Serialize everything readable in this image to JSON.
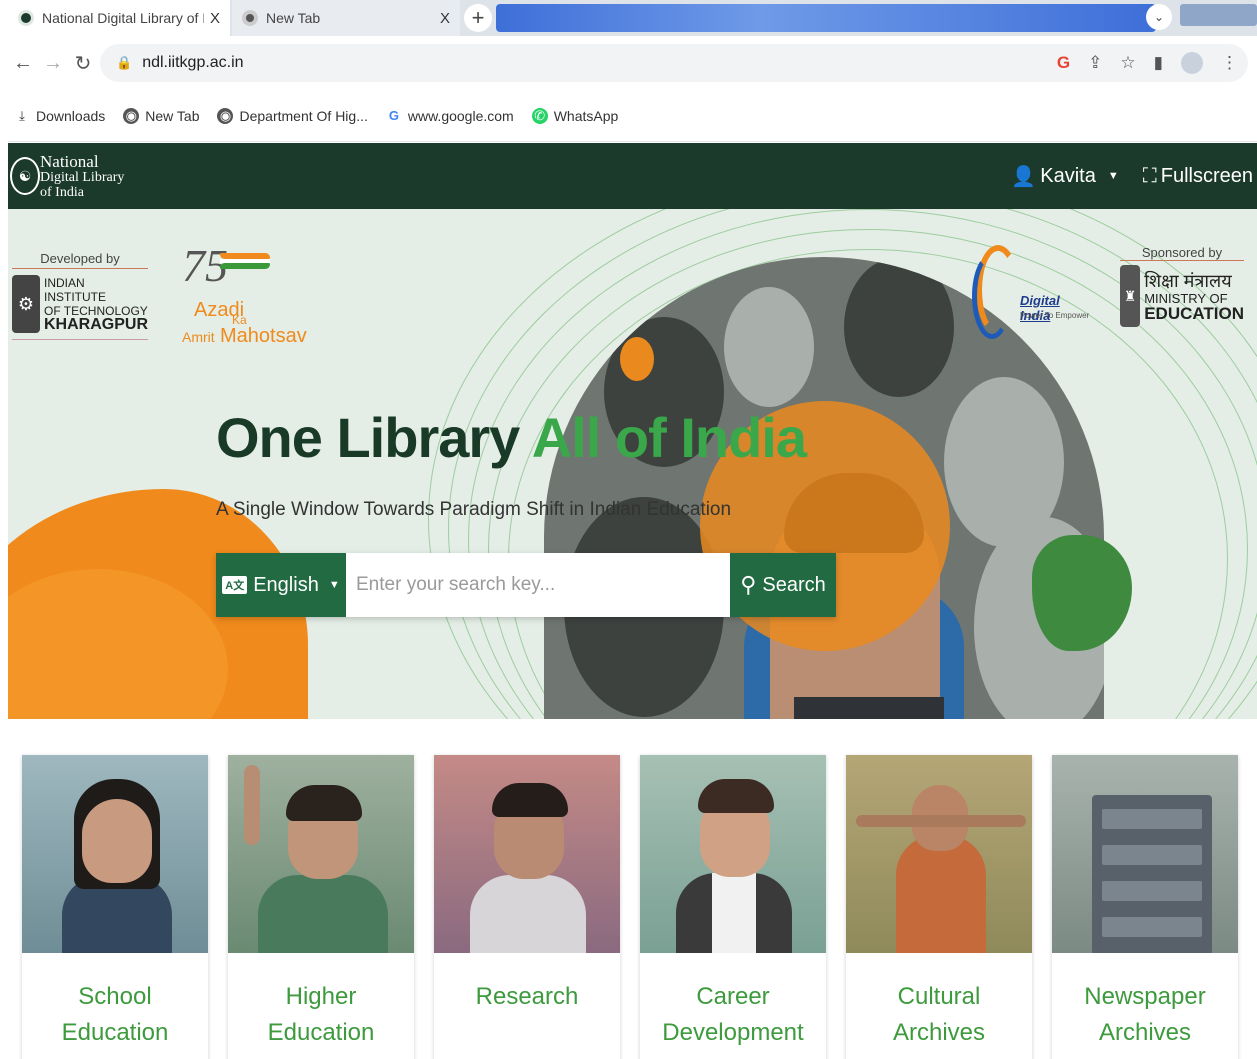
{
  "browser": {
    "tabs": [
      {
        "title": "National Digital Library of India |",
        "close": "X",
        "active": true
      },
      {
        "title": "New Tab",
        "close": "X",
        "active": false
      }
    ],
    "new_tab_symbol": "+",
    "tab_menu_symbol": "⌄",
    "url": "ndl.iitkgp.ac.in",
    "bookmarks": [
      {
        "label": "Downloads",
        "icon": "download-icon"
      },
      {
        "label": "New Tab",
        "icon": "globe-icon"
      },
      {
        "label": "Department Of Hig...",
        "icon": "globe-icon"
      },
      {
        "label": "www.google.com",
        "icon": "google-icon"
      },
      {
        "label": "WhatsApp",
        "icon": "whatsapp-icon"
      }
    ]
  },
  "site": {
    "logo": {
      "line1": "National",
      "line2": "Digital Library",
      "line3": "of India"
    },
    "user_name": "Kavita",
    "fullscreen_label": "Fullscreen"
  },
  "hero": {
    "developed_by_label": "Developed by",
    "iit": {
      "line1": "INDIAN INSTITUTE",
      "line2": "OF TECHNOLOGY",
      "line3": "KHARAGPUR"
    },
    "azadi": {
      "number": "75",
      "word1": "Azadi",
      "word2": "Ka",
      "word3": "Amrit",
      "word4": "Mahotsav"
    },
    "digital_india": {
      "name": "Digital India",
      "tagline": "Power To Empower"
    },
    "sponsored_by_label": "Sponsored by",
    "ministry": {
      "hindi": "शिक्षा मंत्रालय",
      "line1": "MINISTRY OF",
      "line2": "EDUCATION"
    },
    "headline_part1": "One Library ",
    "headline_part2": "All of India",
    "tagline": "A Single Window Towards Paradigm Shift in Indian Education",
    "language": "English",
    "language_icon": "A文",
    "search_placeholder": "Enter your search key...",
    "search_label": "Search"
  },
  "categories": [
    {
      "title": "School Education"
    },
    {
      "title": "Higher Education"
    },
    {
      "title": "Research"
    },
    {
      "title": "Career Development"
    },
    {
      "title": "Cultural Archives"
    },
    {
      "title": "Newspaper Archives"
    }
  ],
  "colors": {
    "header_bg": "#1b3a2c",
    "brand_green": "#216a42",
    "accent_green": "#3aa84a",
    "accent_orange": "#f08a1c",
    "card_title": "#3d9a3d"
  }
}
